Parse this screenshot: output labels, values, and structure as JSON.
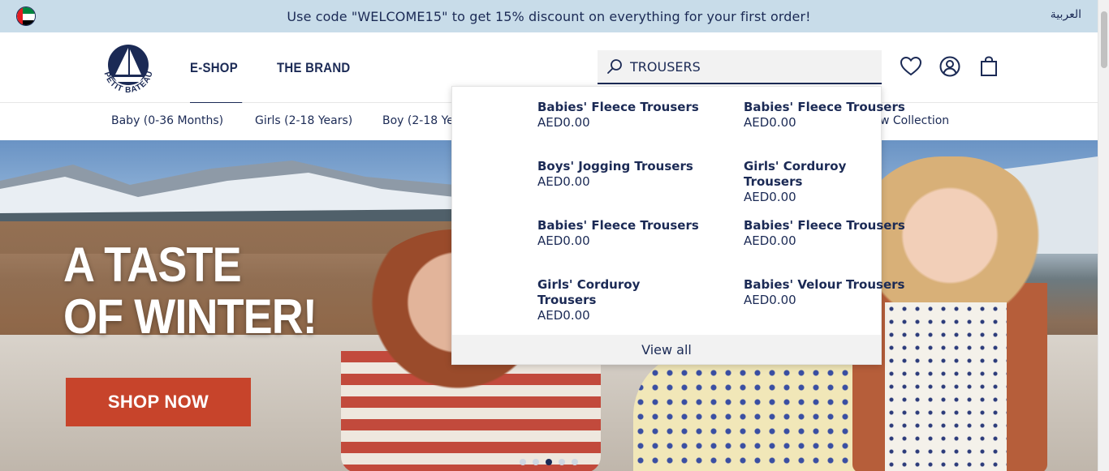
{
  "promo": {
    "text": "Use code \"WELCOME15\" to get 15% discount on everything for your first order!",
    "language_link": "العربية"
  },
  "brand": {
    "logo_text": "PETIT BATEAU"
  },
  "main_nav": [
    {
      "label": "E-SHOP",
      "active": true
    },
    {
      "label": "THE BRAND",
      "active": false
    }
  ],
  "search": {
    "value": "TROUSERS",
    "placeholder": ""
  },
  "header_icons": [
    "heart-icon",
    "account-icon",
    "bag-icon"
  ],
  "categories": [
    "Baby (0-36 Months)",
    "Girls (2-18 Years)",
    "Boy (2-18 Ye",
    "w Collection"
  ],
  "search_results": [
    {
      "name": "Babies' Fleece Trousers",
      "price": "AED0.00"
    },
    {
      "name": "Babies' Fleece Trousers",
      "price": "AED0.00"
    },
    {
      "name": "Boys' Jogging Trousers",
      "price": "AED0.00"
    },
    {
      "name": "Girls' Corduroy Trousers",
      "price": "AED0.00"
    },
    {
      "name": "Babies' Fleece Trousers",
      "price": "AED0.00"
    },
    {
      "name": "Babies' Fleece Trousers",
      "price": "AED0.00"
    },
    {
      "name": "Girls' Corduroy Trousers",
      "price": "AED0.00"
    },
    {
      "name": "Babies' Velour Trousers",
      "price": "AED0.00"
    }
  ],
  "view_all_label": "View all",
  "hero": {
    "title_line1": "A TASTE",
    "title_line2": "OF WINTER!",
    "cta": "SHOP NOW",
    "slides_count": 5,
    "active_slide": 3
  },
  "colors": {
    "navy": "#1b2a55",
    "promo_bg": "#c8dce9",
    "cta": "#c7442b"
  }
}
